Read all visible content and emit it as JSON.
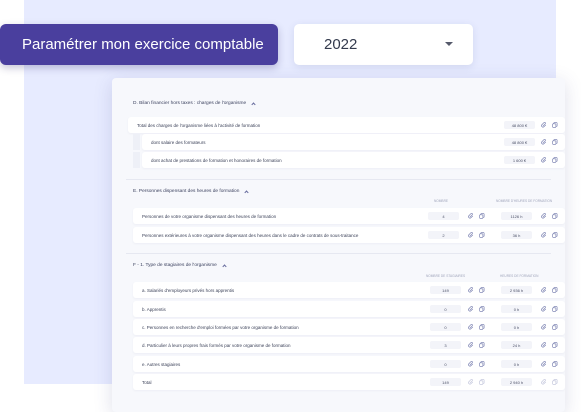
{
  "header": {
    "title": "Paramétrer mon exercice comptable",
    "year_selected": "2022"
  },
  "sections": {
    "d": {
      "title": "D. Bilan financier hors taxes : charges de l'organisme",
      "rows": [
        {
          "label": "Total des charges de l'organisme liées à l'activité de formation",
          "value": "48 800 €"
        },
        {
          "label": "dont salaire des formateurs",
          "value": "48 800 €"
        },
        {
          "label": "dont achat de prestations de formation et honoraires de formation",
          "value": "1 600 €"
        }
      ]
    },
    "e": {
      "title": "E. Personnes dispensant des heures de formation",
      "col_a": "Nombre",
      "col_b": "Nombre d'heures de formation",
      "rows": [
        {
          "label": "Personnes de votre organisme dispensant des heures de formation",
          "a": "4",
          "b": "1126 h"
        },
        {
          "label": "Personnes extérieures à votre organisme dispensant des heures dans le cadre de contrats de sous-traitance",
          "a": "2",
          "b": "36 h"
        }
      ]
    },
    "f": {
      "title": "F - 1. Type de stagiaires de l'organisme",
      "col_a": "Nombre de stagiaires",
      "col_b": "Heures de formation",
      "rows": [
        {
          "label": "a. Salariés d'employeurs privés hors apprentis",
          "a": "149",
          "b": "2 936 h"
        },
        {
          "label": "b. Apprentis",
          "a": "0",
          "b": "0 h"
        },
        {
          "label": "c. Personnes en recherche d'emploi formées par votre organisme de formation",
          "a": "0",
          "b": "0 h"
        },
        {
          "label": "d. Particulier à leurs propres frais formés par votre organisme de formation",
          "a": "3",
          "b": "24 h"
        },
        {
          "label": "e. Autres stagiaires",
          "a": "0",
          "b": "0 h"
        },
        {
          "label": "Total",
          "a": "149",
          "b": "2 940 h"
        }
      ]
    }
  },
  "icons": {
    "attach": "paperclip-icon",
    "copy": "copy-icon",
    "caret": "chevron-down-icon",
    "collapse": "chevron-up-icon"
  },
  "colors": {
    "accent": "#4a3f9e",
    "background_panel": "#e7ebff",
    "icon": "#6b73a8"
  }
}
